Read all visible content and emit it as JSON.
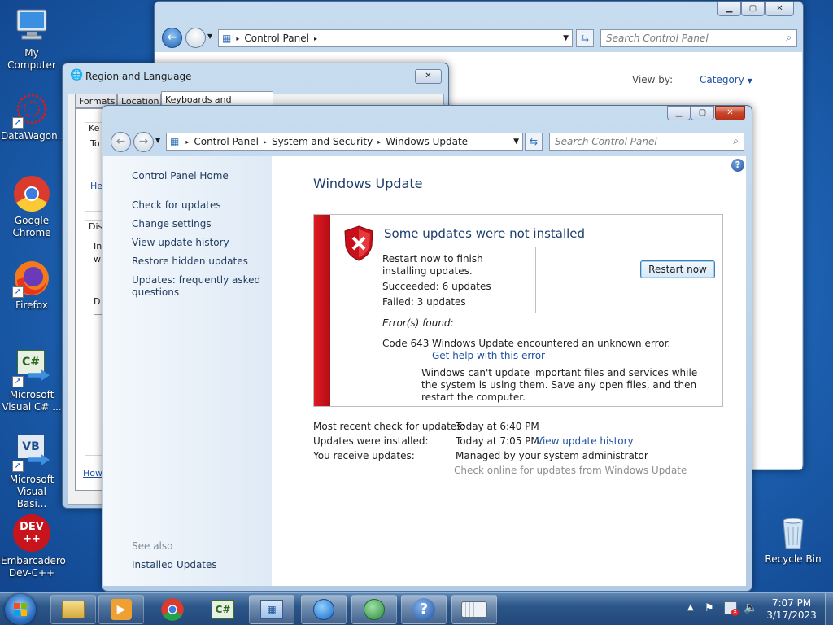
{
  "desktop": {
    "icons": [
      {
        "label": "My Computer",
        "icon": "computer-icon"
      },
      {
        "label": "DataWagon...",
        "icon": "datawagon-icon"
      },
      {
        "label": "Google Chrome",
        "icon": "chrome-icon"
      },
      {
        "label": "Firefox",
        "icon": "firefox-icon"
      },
      {
        "label": "Microsoft Visual C# ...",
        "icon": "csharp-icon",
        "glyph": "C#"
      },
      {
        "label": "Microsoft Visual Basi...",
        "icon": "vb-icon",
        "glyph": "VB"
      },
      {
        "label": "Embarcadero Dev-C++",
        "icon": "devcpp-icon",
        "glyph": "DEV\n++"
      },
      {
        "label": "Recycle Bin",
        "icon": "recycle-bin-icon"
      }
    ]
  },
  "back_window": {
    "breadcrumb": [
      "Control Panel"
    ],
    "search_placeholder": "Search Control Panel",
    "view_by_label": "View by:",
    "view_by_value": "Category"
  },
  "region_window": {
    "title": "Region and Language",
    "tabs": [
      "Formats",
      "Location",
      "Keyboards and Languages"
    ],
    "fragments": [
      "Ke",
      "To",
      "He",
      "Dis",
      "In",
      "w",
      "D",
      "How"
    ]
  },
  "wu_window": {
    "breadcrumb": [
      "Control Panel",
      "System and Security",
      "Windows Update"
    ],
    "search_placeholder": "Search Control Panel",
    "sidebar": {
      "home": "Control Panel Home",
      "links": [
        "Check for updates",
        "Change settings",
        "View update history",
        "Restore hidden updates",
        "Updates: frequently asked questions"
      ],
      "see_also": "See also",
      "see_also_links": [
        "Installed Updates"
      ]
    },
    "main": {
      "title": "Windows Update",
      "panel": {
        "heading": "Some updates were not installed",
        "restart_msg": "Restart now to finish installing updates.",
        "succeeded": "Succeeded: 6 updates",
        "failed": "Failed: 3 updates",
        "restart_button": "Restart now",
        "errors_found": "Error(s) found:",
        "error_code": "Code 643",
        "error_msg": "Windows Update encountered an unknown error.",
        "help_link": "Get help with this error",
        "note": "Windows can't update important files and services while the system is using them. Save any open files, and then restart the computer."
      },
      "info": [
        {
          "label": "Most recent check for updates:",
          "value": "Today at 6:40 PM"
        },
        {
          "label": "Updates were installed:",
          "value": "Today at 7:05 PM.",
          "link": "View update history"
        },
        {
          "label": "You receive updates:",
          "value": "Managed by your system administrator"
        }
      ],
      "online_link": "Check online for updates from Windows Update"
    }
  },
  "taskbar": {
    "items": [
      "folder-icon",
      "media-player-icon",
      "chrome-icon",
      "csharp-icon",
      "control-panel-icon",
      "network-globe-icon",
      "windows-update-icon",
      "help-icon",
      "keyboard-icon"
    ],
    "time": "7:07 PM",
    "date": "3/17/2023"
  },
  "colors": {
    "accent": "#1f50a4",
    "error_bar": "#c8101a"
  }
}
